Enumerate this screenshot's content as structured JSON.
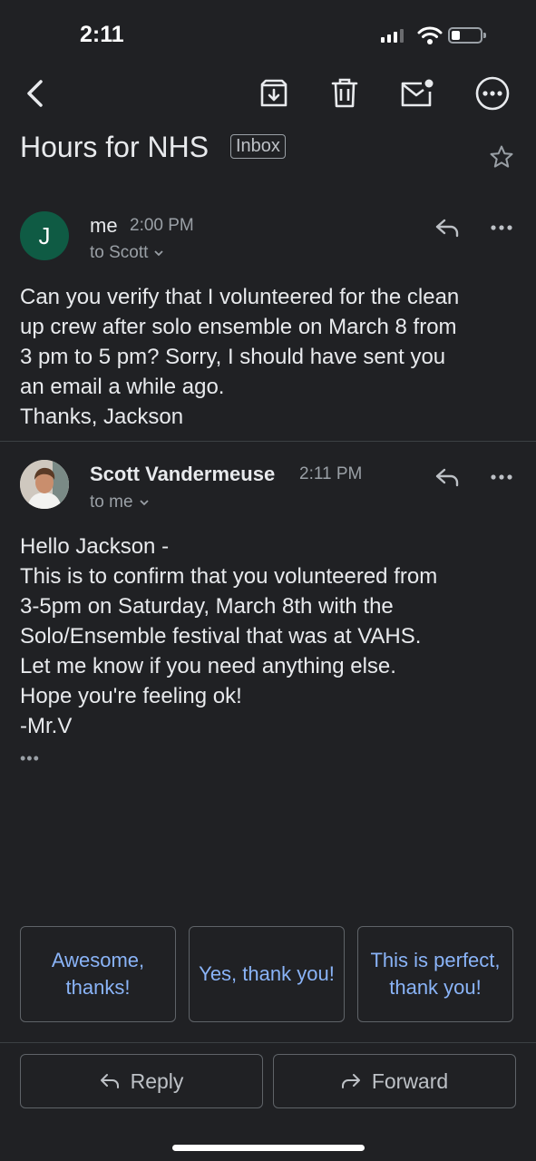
{
  "status_bar": {
    "time": "2:11"
  },
  "header": {
    "icons": [
      "back-icon",
      "archive-icon",
      "trash-icon",
      "mark-unread-icon",
      "more-icon"
    ]
  },
  "subject": {
    "title": "Hours for NHS",
    "label": "Inbox"
  },
  "messages": [
    {
      "avatar_letter": "J",
      "avatar_color": "#0f5b44",
      "sender": "me",
      "time": "2:00 PM",
      "recipient": "to Scott",
      "body": [
        "Can you verify that I volunteered for the clean",
        "up crew after solo ensemble on March 8 from",
        "3 pm to 5 pm? Sorry, I should have sent you",
        "an email a while ago.",
        "Thanks, Jackson"
      ]
    },
    {
      "sender": "Scott Vandermeuse",
      "time": "2:11 PM",
      "recipient": "to me",
      "body": [
        "Hello Jackson -",
        "This is to confirm that you volunteered from",
        "3-5pm on Saturday, March 8th with the",
        "Solo/Ensemble festival that was at VAHS.",
        "Let me know if you need anything else.",
        "Hope you're feeling ok!",
        "-Mr.V"
      ],
      "trimmed": "•••"
    }
  ],
  "smart_replies": [
    "Awesome, thanks!",
    "Yes, thank you!",
    "This is perfect, thank you!"
  ],
  "actions": {
    "reply": "Reply",
    "forward": "Forward"
  },
  "colors": {
    "background": "#202124",
    "accent": "#8ab4f8"
  }
}
